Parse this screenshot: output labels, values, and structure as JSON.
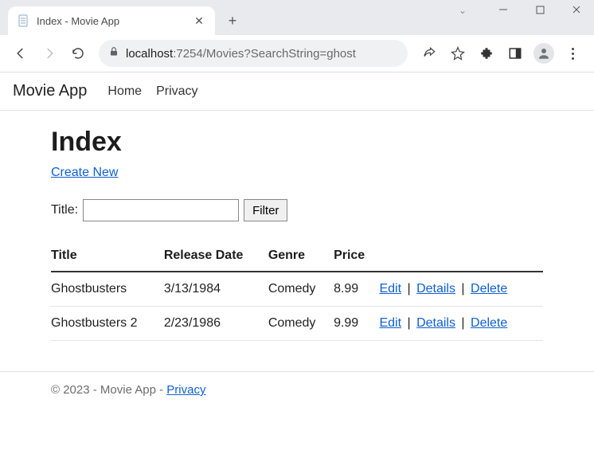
{
  "browser": {
    "tab_title": "Index - Movie App",
    "url_host": "localhost",
    "url_port_path": ":7254/Movies?SearchString=ghost"
  },
  "navbar": {
    "brand": "Movie App",
    "links": [
      "Home",
      "Privacy"
    ]
  },
  "page": {
    "heading": "Index",
    "create_link": "Create New",
    "filter": {
      "label": "Title:",
      "value": "",
      "button": "Filter"
    },
    "table": {
      "headers": [
        "Title",
        "Release Date",
        "Genre",
        "Price"
      ],
      "rows": [
        {
          "title": "Ghostbusters",
          "release_date": "3/13/1984",
          "genre": "Comedy",
          "price": "8.99"
        },
        {
          "title": "Ghostbusters 2",
          "release_date": "2/23/1986",
          "genre": "Comedy",
          "price": "9.99"
        }
      ],
      "actions": {
        "edit": "Edit",
        "details": "Details",
        "delete": "Delete"
      }
    }
  },
  "footer": {
    "text": "© 2023 - Movie App - ",
    "privacy": "Privacy"
  }
}
